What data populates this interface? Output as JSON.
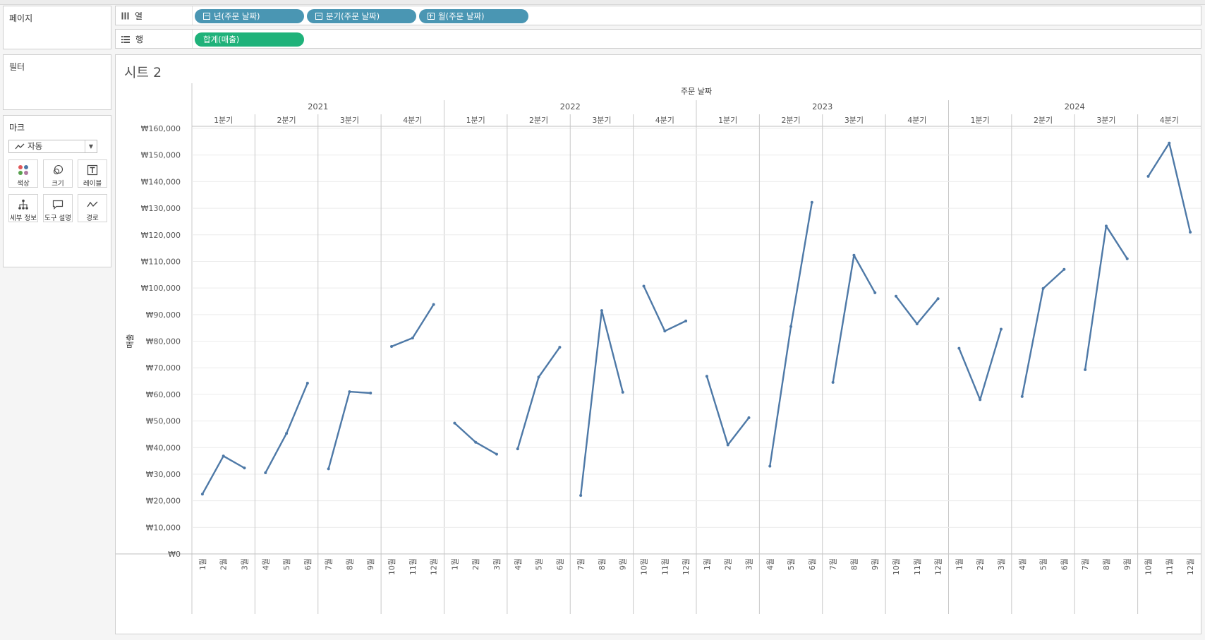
{
  "shelves": {
    "pages_label": "페이지",
    "columns_label": "열",
    "rows_label": "행",
    "column_pills": [
      "년(주문 날짜)",
      "분기(주문 날짜)",
      "월(주문 날짜)"
    ],
    "row_pills": [
      "합계(매출)"
    ]
  },
  "filters": {
    "label": "필터"
  },
  "marks": {
    "label": "마크",
    "type": "자동",
    "buttons": [
      "색상",
      "크기",
      "레이블",
      "세부 정보",
      "도구 설명",
      "경로"
    ]
  },
  "sheet": {
    "title": "시트 2"
  },
  "chart_data": {
    "type": "line",
    "header_title": "주문 날짜",
    "years": [
      "2021",
      "2022",
      "2023",
      "2024"
    ],
    "quarters": [
      "1분기",
      "2분기",
      "3분기",
      "4분기"
    ],
    "month_labels": [
      "1월",
      "2월",
      "3월",
      "4월",
      "5월",
      "6월",
      "7월",
      "8월",
      "9월",
      "10월",
      "11월",
      "12월"
    ],
    "ylabel": "매출",
    "ylim": [
      0,
      160000
    ],
    "yticks": [
      0,
      10000,
      20000,
      30000,
      40000,
      50000,
      60000,
      70000,
      80000,
      90000,
      100000,
      110000,
      120000,
      130000,
      140000,
      150000,
      160000
    ],
    "ytick_labels": [
      "₩0",
      "₩10,000",
      "₩20,000",
      "₩30,000",
      "₩40,000",
      "₩50,000",
      "₩60,000",
      "₩70,000",
      "₩80,000",
      "₩90,000",
      "₩100,000",
      "₩110,000",
      "₩120,000",
      "₩130,000",
      "₩140,000",
      "₩150,000",
      "₩160,000"
    ],
    "values": [
      [
        22500,
        36800,
        32300
      ],
      [
        30500,
        45300,
        64200
      ],
      [
        32000,
        61000,
        60500
      ],
      [
        78000,
        81200,
        93800
      ],
      [
        49200,
        42000,
        37500
      ],
      [
        39500,
        66500,
        77700
      ],
      [
        22000,
        91500,
        60800
      ],
      [
        100700,
        83800,
        87600
      ],
      [
        66800,
        41000,
        51200
      ],
      [
        33000,
        85500,
        132200
      ],
      [
        64500,
        112300,
        98200
      ],
      [
        96900,
        86500,
        96000
      ],
      [
        77300,
        58000,
        84500
      ],
      [
        59200,
        99800,
        107000
      ],
      [
        69300,
        123300,
        111000
      ],
      [
        142000,
        154500,
        121000
      ]
    ],
    "line_color": "#4e79a7",
    "grid": true
  }
}
